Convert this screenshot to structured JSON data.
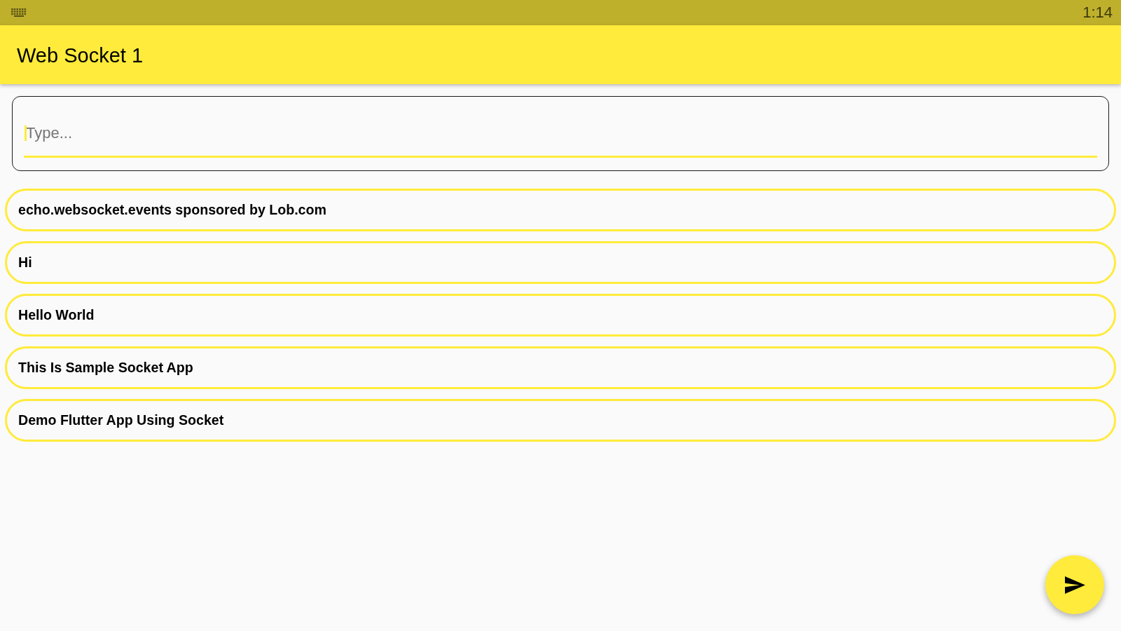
{
  "status_bar": {
    "time": "1:14"
  },
  "app_bar": {
    "title": "Web Socket 1"
  },
  "message_field": {
    "placeholder": "Type...",
    "focused": true
  },
  "messages": [
    {
      "text": "echo.websocket.events sponsored by Lob.com"
    },
    {
      "text": "Hi"
    },
    {
      "text": "Hello World"
    },
    {
      "text": "This Is Sample Socket App"
    },
    {
      "text": "Demo Flutter App Using Socket"
    }
  ]
}
